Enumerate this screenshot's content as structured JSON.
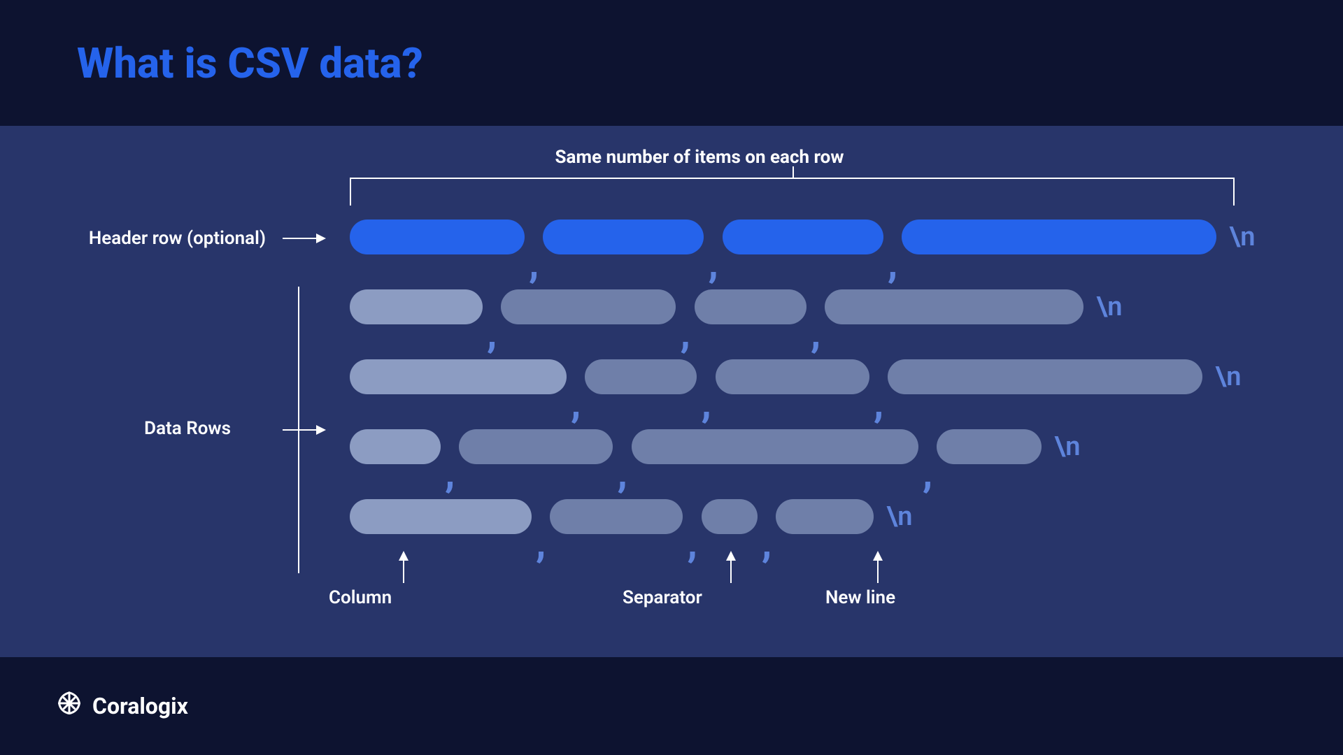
{
  "title": "What is CSV data?",
  "brand": "Coralogix",
  "labels": {
    "top_caption": "Same number of items on each row",
    "header_row": "Header row (optional)",
    "data_rows": "Data Rows",
    "column": "Column",
    "separator": "Separator",
    "newline": "New line"
  },
  "tokens": {
    "comma": ",",
    "newline": "\\n"
  },
  "rows": {
    "header": {
      "pill_widths": [
        250,
        230,
        230,
        450
      ],
      "style": "blue"
    },
    "data": [
      {
        "pill_widths": [
          190,
          250,
          160,
          370
        ],
        "first_lighter": true
      },
      {
        "pill_widths": [
          310,
          160,
          220,
          450
        ],
        "first_lighter": true
      },
      {
        "pill_widths": [
          130,
          220,
          410,
          150
        ],
        "first_lighter": true
      },
      {
        "pill_widths": [
          260,
          190,
          80,
          140
        ],
        "first_lighter": true
      }
    ]
  }
}
